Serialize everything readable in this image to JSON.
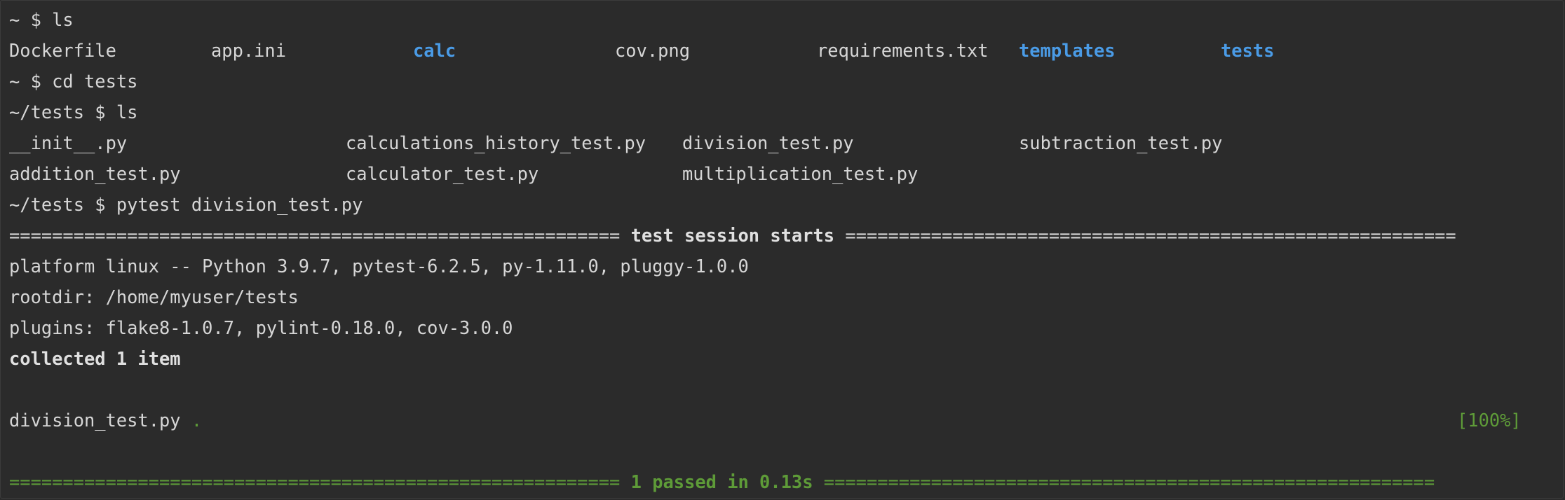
{
  "commands": {
    "ls1": "~ $ ls",
    "cd": "~ $ cd tests",
    "ls2": "~/tests $ ls",
    "pytest": "~/tests $ pytest division_test.py"
  },
  "root_listing": [
    {
      "name": "Dockerfile",
      "type": "file"
    },
    {
      "name": "app.ini",
      "type": "file"
    },
    {
      "name": "calc",
      "type": "dir"
    },
    {
      "name": "cov.png",
      "type": "file"
    },
    {
      "name": "requirements.txt",
      "type": "file"
    },
    {
      "name": "templates",
      "type": "dir"
    },
    {
      "name": "tests",
      "type": "dir"
    }
  ],
  "tests_listing": [
    [
      "__init__.py",
      "calculations_history_test.py",
      "division_test.py",
      "subtraction_test.py"
    ],
    [
      "addition_test.py",
      "calculator_test.py",
      "multiplication_test.py"
    ]
  ],
  "session": {
    "header_left": "=========================================================",
    "header_title": "test session starts",
    "header_right": "=========================================================",
    "platform": "platform linux -- Python 3.9.7, pytest-6.2.5, py-1.11.0, pluggy-1.0.0",
    "rootdir": "rootdir: /home/myuser/tests",
    "plugins": "plugins: flake8-1.0.7, pylint-0.18.0, cov-3.0.0",
    "collected": "collected 1 item",
    "test_file": "division_test.py",
    "test_dots": ".",
    "percent": "[100%]",
    "footer_left": "=========================================================",
    "footer_title": "1 passed in 0.13s",
    "footer_right": "========================================================="
  },
  "colors": {
    "background": "#2b2b2b",
    "text": "#d6d6d6",
    "directory": "#4a9be6",
    "pass_green": "#5e9b38"
  }
}
